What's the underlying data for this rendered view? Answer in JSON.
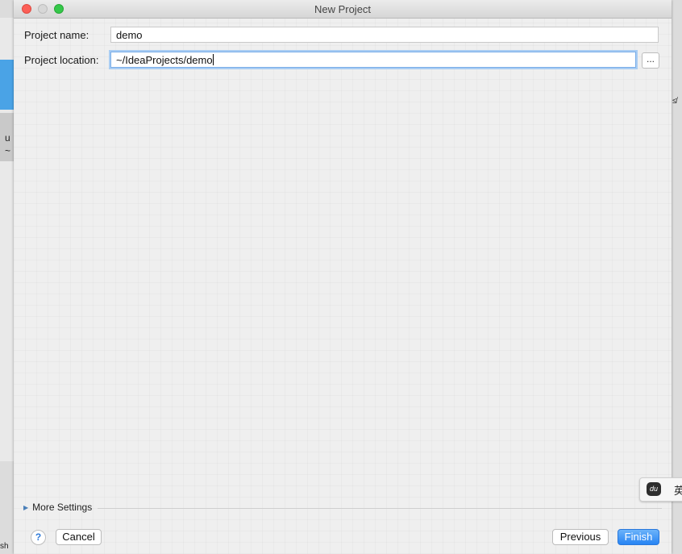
{
  "background": {
    "left_text_1": "u",
    "left_text_2": "~",
    "bottom_left_text": "sh",
    "right_text": "≰"
  },
  "window": {
    "title": "New Project"
  },
  "form": {
    "project_name_label": "Project name:",
    "project_name_value": "demo",
    "project_location_label": "Project location:",
    "project_location_value": "~/IdeaProjects/demo",
    "browse_label": "..."
  },
  "more_settings": {
    "label": "More Settings",
    "expanded": false
  },
  "footer": {
    "help_label": "?",
    "cancel_label": "Cancel",
    "previous_label": "Previous",
    "finish_label": "Finish"
  },
  "ime": {
    "logo": "du",
    "mode": "英"
  },
  "colors": {
    "accent": "#2784f3",
    "focus_ring": "#a9cdf3",
    "close": "#fc5f57",
    "maximize": "#35c84a"
  }
}
